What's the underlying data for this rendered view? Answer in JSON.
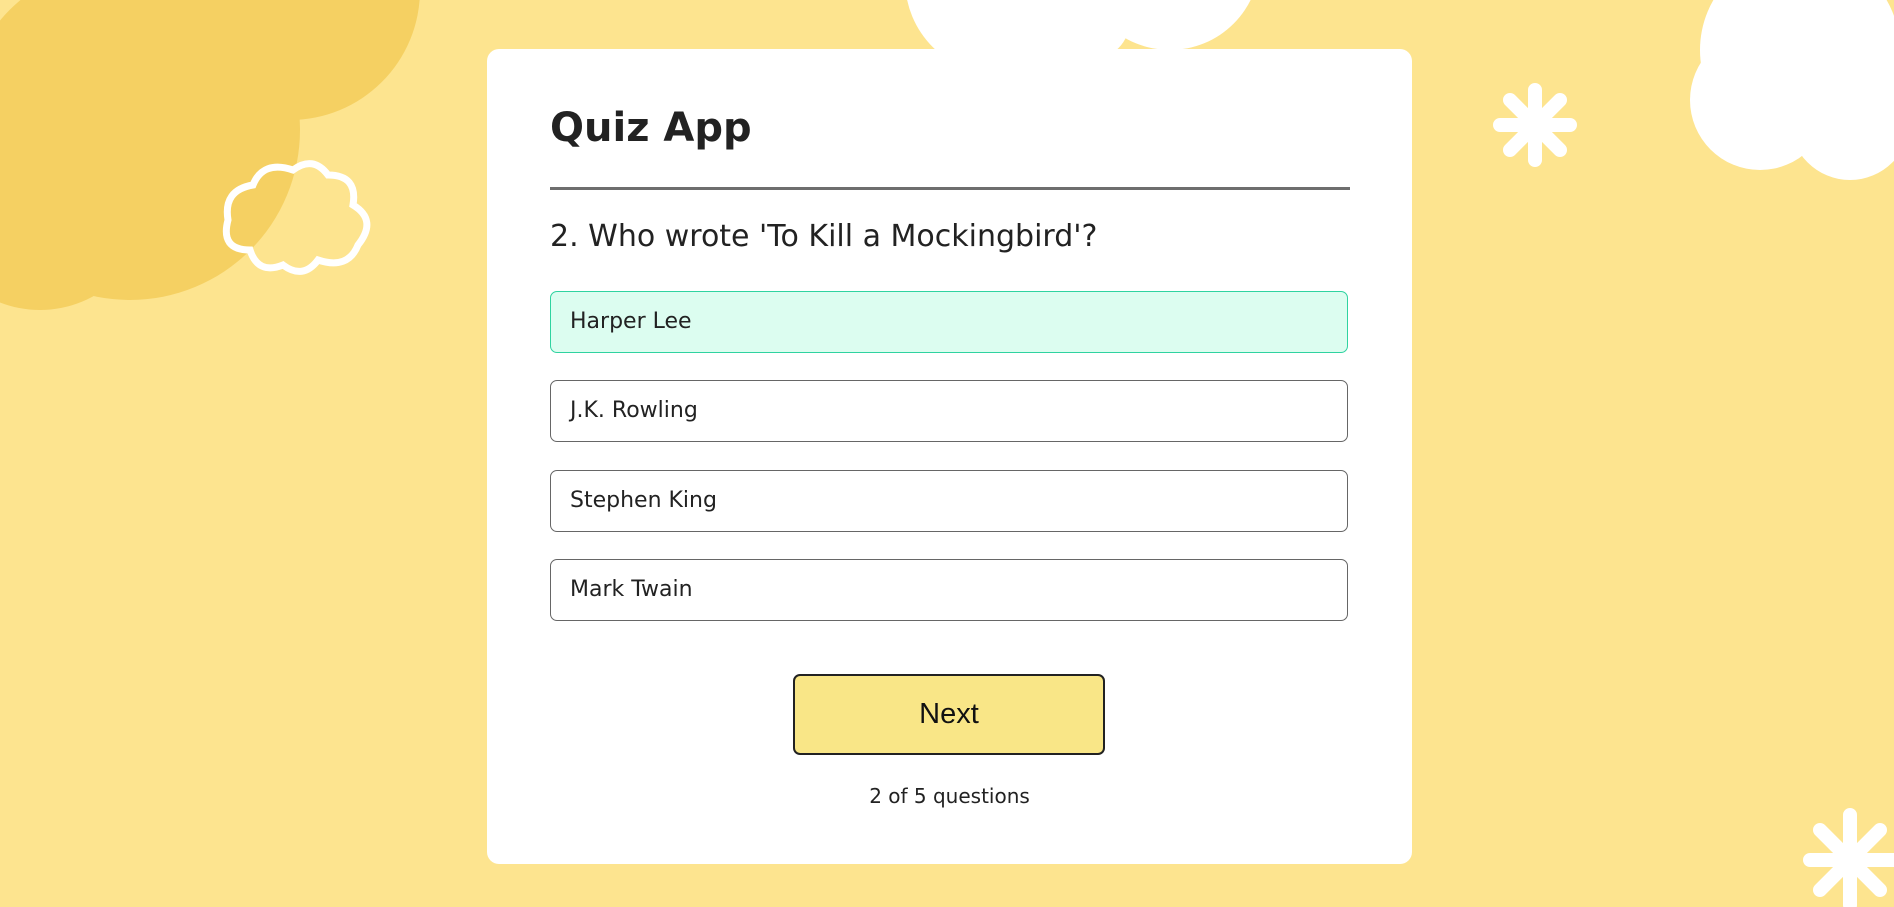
{
  "app": {
    "title": "Quiz App"
  },
  "question": {
    "text": "2. Who wrote 'To Kill a Mockingbird'?"
  },
  "options": [
    {
      "label": "Harper Lee",
      "selected": true
    },
    {
      "label": "J.K. Rowling",
      "selected": false
    },
    {
      "label": "Stephen King",
      "selected": false
    },
    {
      "label": "Mark Twain",
      "selected": false
    }
  ],
  "next_button": {
    "label": "Next"
  },
  "progress": {
    "text": "2 of 5 questions",
    "current": 2,
    "total": 5
  },
  "colors": {
    "background": "#fde48f",
    "selected_option": "#dcfdf0",
    "selected_border": "#2fd3a0",
    "button": "#f9e687"
  }
}
